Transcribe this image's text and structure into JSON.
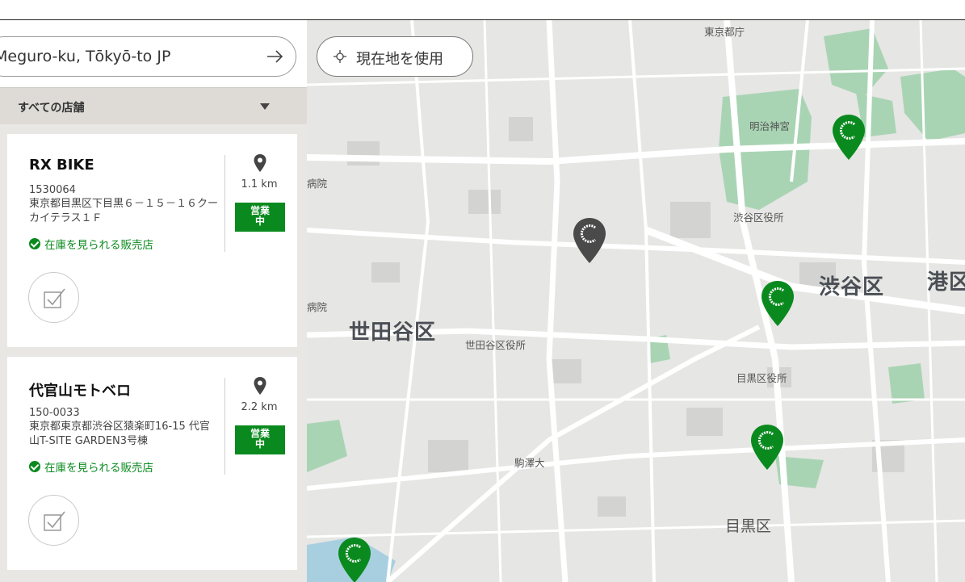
{
  "search": {
    "value": "Meguro-ku, Tōkyō-to JP",
    "submit_icon": "arrow-right-icon"
  },
  "filter": {
    "selected": "すべての店舗",
    "icon": "caret-down-icon"
  },
  "stores": [
    {
      "name": "RX BIKE",
      "zip": "1530064",
      "address": "東京都目黒区下目黒６－１５－１６クーカイテラス１Ｆ",
      "stock_label": "在庫を見られる販売店",
      "distance": "1.1 km",
      "status": "営業\n中"
    },
    {
      "name": "代官山モトベロ",
      "zip": "150-0033",
      "address": "東京都東京都渋谷区猿楽町16-15 代官山T-SITE GARDEN3号棟",
      "stock_label": "在庫を見られる販売店",
      "distance": "2.2 km",
      "status": "営業\n中"
    }
  ],
  "map": {
    "use_location_label": "現在地を使用",
    "labels": {
      "tokyo": "東京都庁",
      "meiji": "明治神宮",
      "shibuya_office": "渋谷区役所",
      "shibuya": "渋谷区",
      "minato": "港区",
      "setagaya": "世田谷区",
      "setagaya_office": "世田谷区役所",
      "meguro_office": "目黒区役所",
      "komazawa": "駒澤大",
      "meguro": "目黒区",
      "hospital1": "病院",
      "hospital2": "病院"
    },
    "colors": {
      "store_marker": "#0a8a1e",
      "selected_marker": "#4a4a4a",
      "park": "#a9d4b4",
      "road": "#ffffff"
    }
  }
}
